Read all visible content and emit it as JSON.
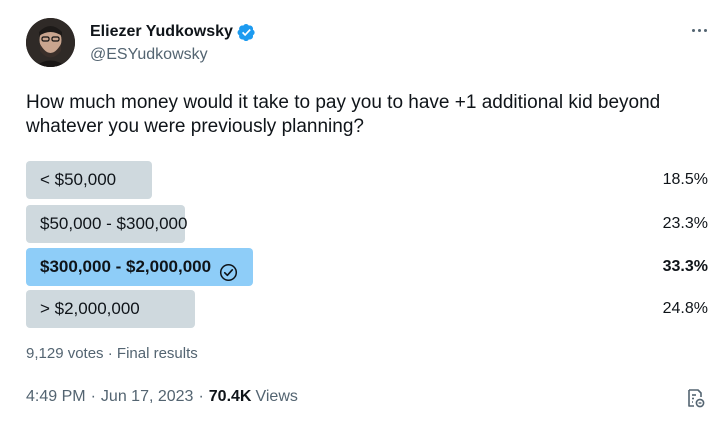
{
  "author": {
    "name": "Eliezer Yudkowsky",
    "handle": "@ESYudkowsky",
    "verified_icon": "verified-badge-icon",
    "avatar_icon": "avatar"
  },
  "tweet": {
    "text": "How much money would it take to pay you to have +1 additional kid beyond whatever you were previously planning?"
  },
  "poll": {
    "options": [
      {
        "label": "< $50,000",
        "percent_text": "18.5%",
        "percent": 18.5,
        "winner": false
      },
      {
        "label": "$50,000 - $300,000",
        "percent_text": "23.3%",
        "percent": 23.3,
        "winner": false
      },
      {
        "label": "$300,000 - $2,000,000",
        "percent_text": "33.3%",
        "percent": 33.3,
        "winner": true
      },
      {
        "label": "> $2,000,000",
        "percent_text": "24.8%",
        "percent": 24.8,
        "winner": false
      }
    ],
    "votes": "9,129 votes",
    "separator": "·",
    "status": "Final results"
  },
  "footer": {
    "time": "4:49 PM",
    "separator": "·",
    "date": "Jun 17, 2023",
    "views_count": "70.4K",
    "views_label": "Views"
  },
  "colors": {
    "bar": "#cfd9de",
    "bar_winner": "#8ecdf8",
    "verified": "#1d9bf0",
    "secondary_text": "#536471"
  }
}
